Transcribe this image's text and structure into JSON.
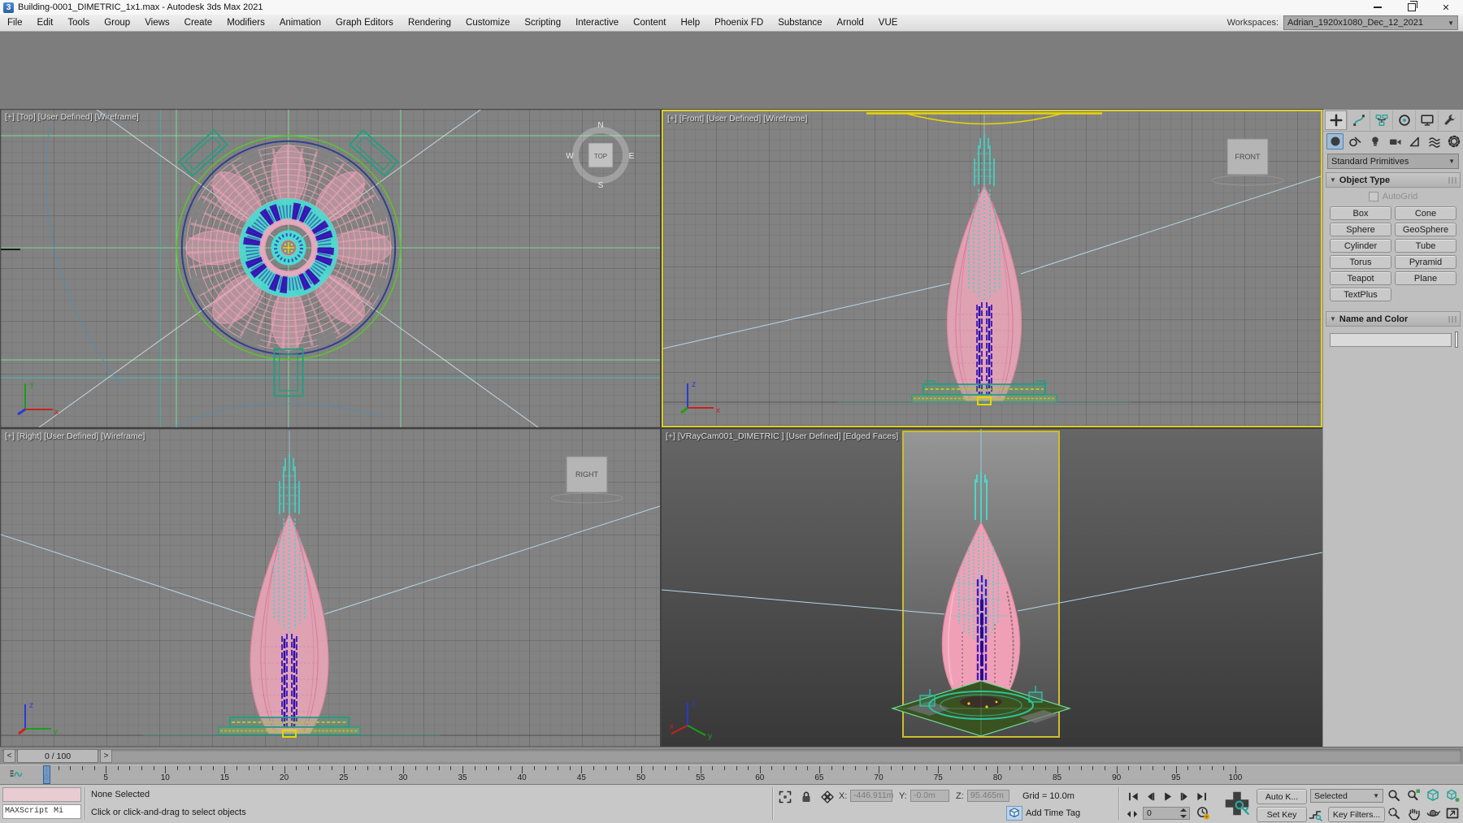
{
  "window": {
    "icon_text": "3",
    "title": "Building-0001_DIMETRIC_1x1.max - Autodesk 3ds Max 2021",
    "close_glyph": "✕"
  },
  "menu": {
    "items": [
      "File",
      "Edit",
      "Tools",
      "Group",
      "Views",
      "Create",
      "Modifiers",
      "Animation",
      "Graph Editors",
      "Rendering",
      "Customize",
      "Scripting",
      "Interactive",
      "Content",
      "Help",
      "Phoenix FD",
      "Substance",
      "Arnold",
      "VUE"
    ]
  },
  "workspaces": {
    "label": "Workspaces:",
    "value": "Adrian_1920x1080_Dec_12_2021"
  },
  "viewports": {
    "top": {
      "label": "[+] [Top] [User Defined] [Wireframe]",
      "compass": {
        "n": "N",
        "w": "W",
        "e": "E",
        "s": "S",
        "face": "TOP"
      },
      "axes": {
        "x": "x",
        "y": "y"
      }
    },
    "front": {
      "label": "[+] [Front] [User Defined] [Wireframe]",
      "cube": "FRONT",
      "axes": {
        "x": "x",
        "z": "z"
      }
    },
    "right": {
      "label": "[+] [Right] [User Defined] [Wireframe]",
      "cube": "RIGHT",
      "axes": {
        "y": "y",
        "z": "z"
      }
    },
    "camera": {
      "label": "[+] [VRayCam001_DIMETRIC ] [User Defined] [Edged Faces]",
      "axes": {
        "x": "x",
        "y": "y",
        "z": "z"
      }
    }
  },
  "command_panel": {
    "tabs": [
      "create",
      "modify",
      "hierarchy",
      "motion",
      "display",
      "utilities"
    ],
    "active_tab": "create",
    "categories": [
      "geometry",
      "shapes",
      "lights",
      "cameras",
      "helpers",
      "space-warps",
      "systems"
    ],
    "active_category": "geometry",
    "category_dropdown": "Standard Primitives",
    "object_type": {
      "title": "Object Type",
      "autogrid_label": "AutoGrid",
      "buttons": [
        "Box",
        "Cone",
        "Sphere",
        "GeoSphere",
        "Cylinder",
        "Tube",
        "Torus",
        "Pyramid",
        "Teapot",
        "Plane",
        "TextPlus"
      ]
    },
    "name_color": {
      "title": "Name and Color",
      "name_value": "",
      "swatch_color": "#000000"
    }
  },
  "timeline": {
    "slider_text": "0 / 100",
    "prev_glyph": "<",
    "next_glyph": ">",
    "ruler": {
      "min": 0,
      "max": 100,
      "label_step": 5,
      "current_frame": 0
    }
  },
  "status": {
    "maxscript_text": "MAXScript Mi",
    "selection": "None Selected",
    "prompt": "Click or click-and-drag to select objects",
    "x_label": "X:",
    "x_value": "-446.911m",
    "y_label": "Y:",
    "y_value": "-0.0m",
    "z_label": "Z:",
    "z_value": "95.465m",
    "grid_label": "Grid = 10.0m",
    "time_tag": "Add Time Tag",
    "frame_value": "0",
    "auto_key": "Auto K...",
    "set_key": "Set Key",
    "selected_mode": "Selected",
    "key_filters": "Key Filters...",
    "playback": [
      "go-to-start",
      "previous-frame",
      "play",
      "next-frame",
      "go-to-end"
    ],
    "nav_icons": [
      "zoom",
      "zoom-all",
      "zoom-extents-selected",
      "zoom-extents-all",
      "zoom-region",
      "pan",
      "orbit",
      "maximize-viewport-toggle"
    ]
  },
  "colors": {
    "active_viewport_border": "#ddcd28",
    "wire_pink": "#f2a6bc",
    "wire_cyan": "#3fd8c8",
    "wire_purple": "#4a22c4",
    "wire_teal": "#1fa080",
    "wire_lime": "#58c828",
    "wire_navy": "#2b3f8e",
    "selection_yellow": "#e8d400",
    "marker_blue": "#6a96c8"
  }
}
